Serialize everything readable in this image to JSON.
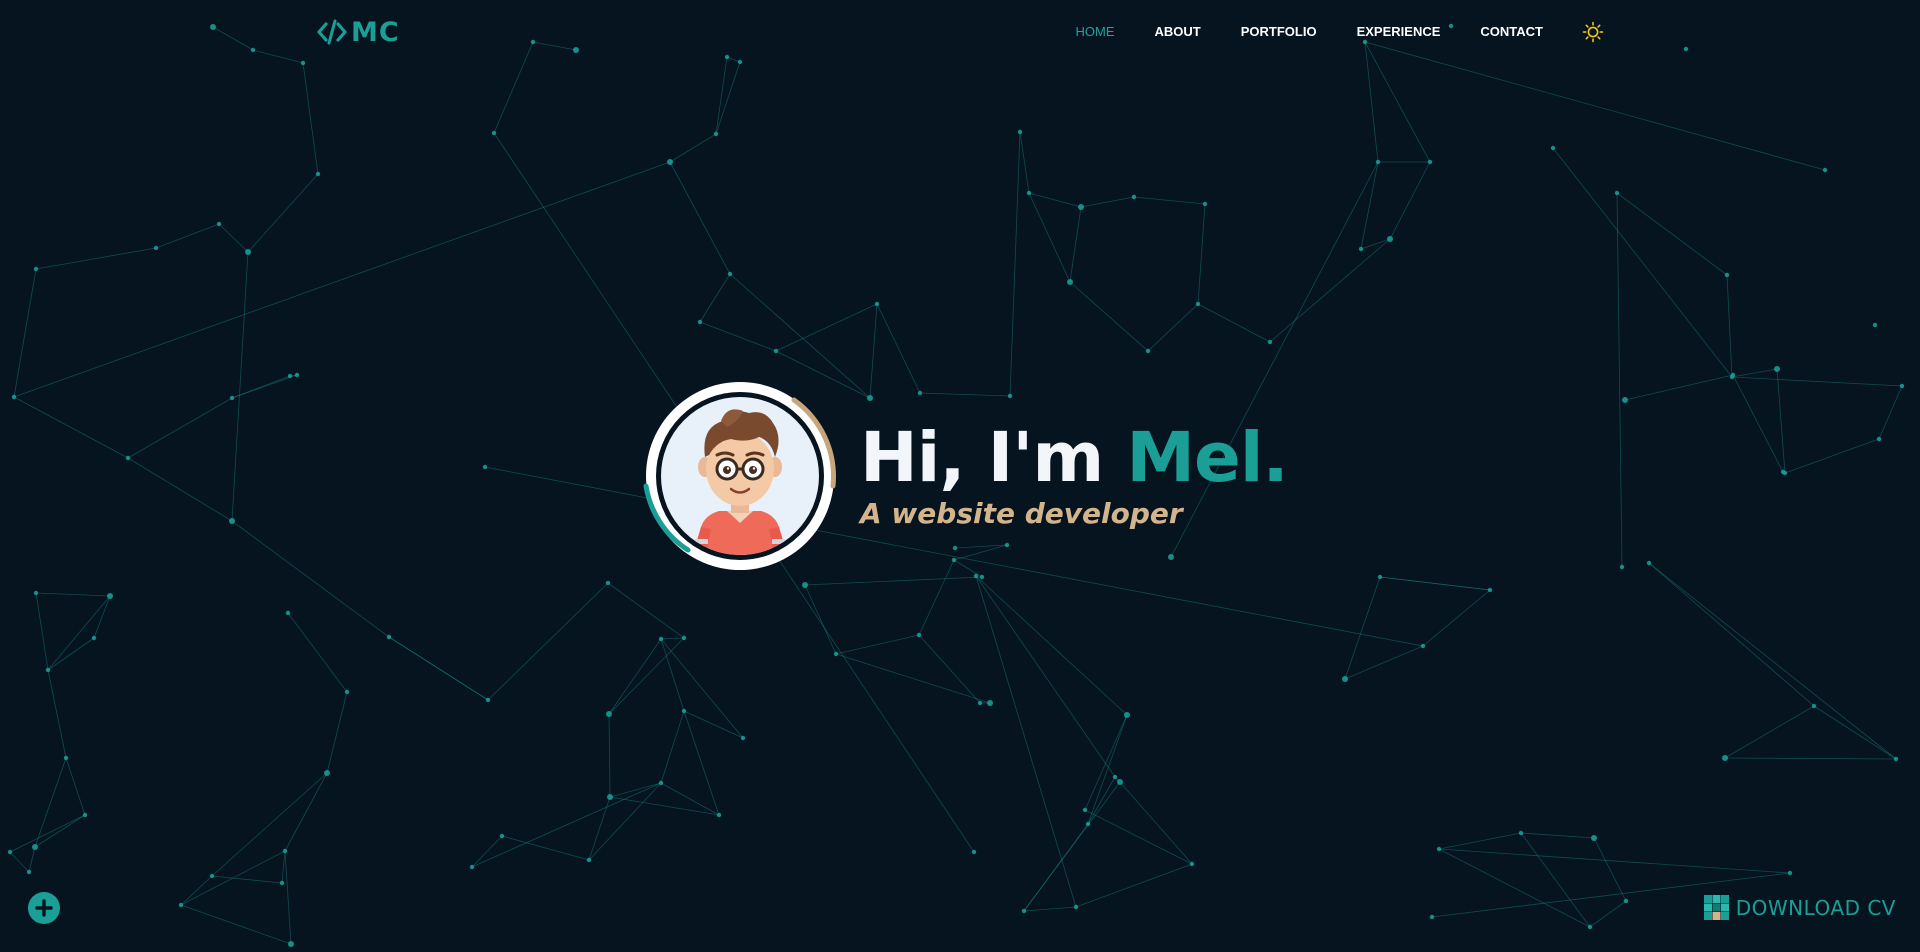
{
  "theme": {
    "background": "#061420",
    "accent": "#1a9e96",
    "accent_secondary": "#d4b48c",
    "text": "#ffffff",
    "icon_sun": "#f5c518"
  },
  "logo": {
    "icon": "code-brackets-icon",
    "text": "MC"
  },
  "nav": {
    "items": [
      {
        "label": "HOME",
        "active": true
      },
      {
        "label": "ABOUT",
        "active": false
      },
      {
        "label": "PORTFOLIO",
        "active": false
      },
      {
        "label": "EXPERIENCE",
        "active": false
      },
      {
        "label": "CONTACT",
        "active": false
      }
    ],
    "theme_toggle_icon": "sun-icon"
  },
  "hero": {
    "avatar_icon": "cartoon-avatar-icon",
    "greeting": "Hi, I'm ",
    "name": "Mel.",
    "subtitle": "A website developer"
  },
  "floating_button": {
    "icon": "plus-icon"
  },
  "download": {
    "icon": "pixel-grid-icon",
    "label": "DOWNLOAD CV"
  }
}
